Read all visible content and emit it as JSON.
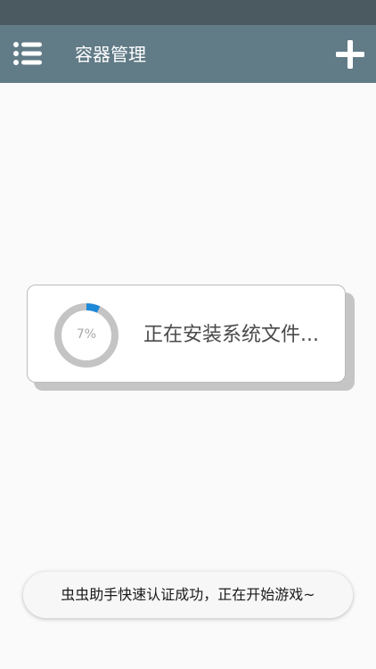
{
  "app_bar": {
    "title": "容器管理",
    "menu_icon": "list-menu-icon",
    "add_icon": "plus-icon"
  },
  "install_card": {
    "progress_percent": 7,
    "progress_label": "7%",
    "message": "正在安装系统文件..."
  },
  "toast": {
    "message": "虫虫助手快速认证成功，正在开始游戏~"
  },
  "colors": {
    "status_bar": "#4b5a61",
    "app_bar": "#617b87",
    "progress_track": "#c4c4c4",
    "progress_fill": "#1e88d9",
    "background": "#fafafa"
  }
}
